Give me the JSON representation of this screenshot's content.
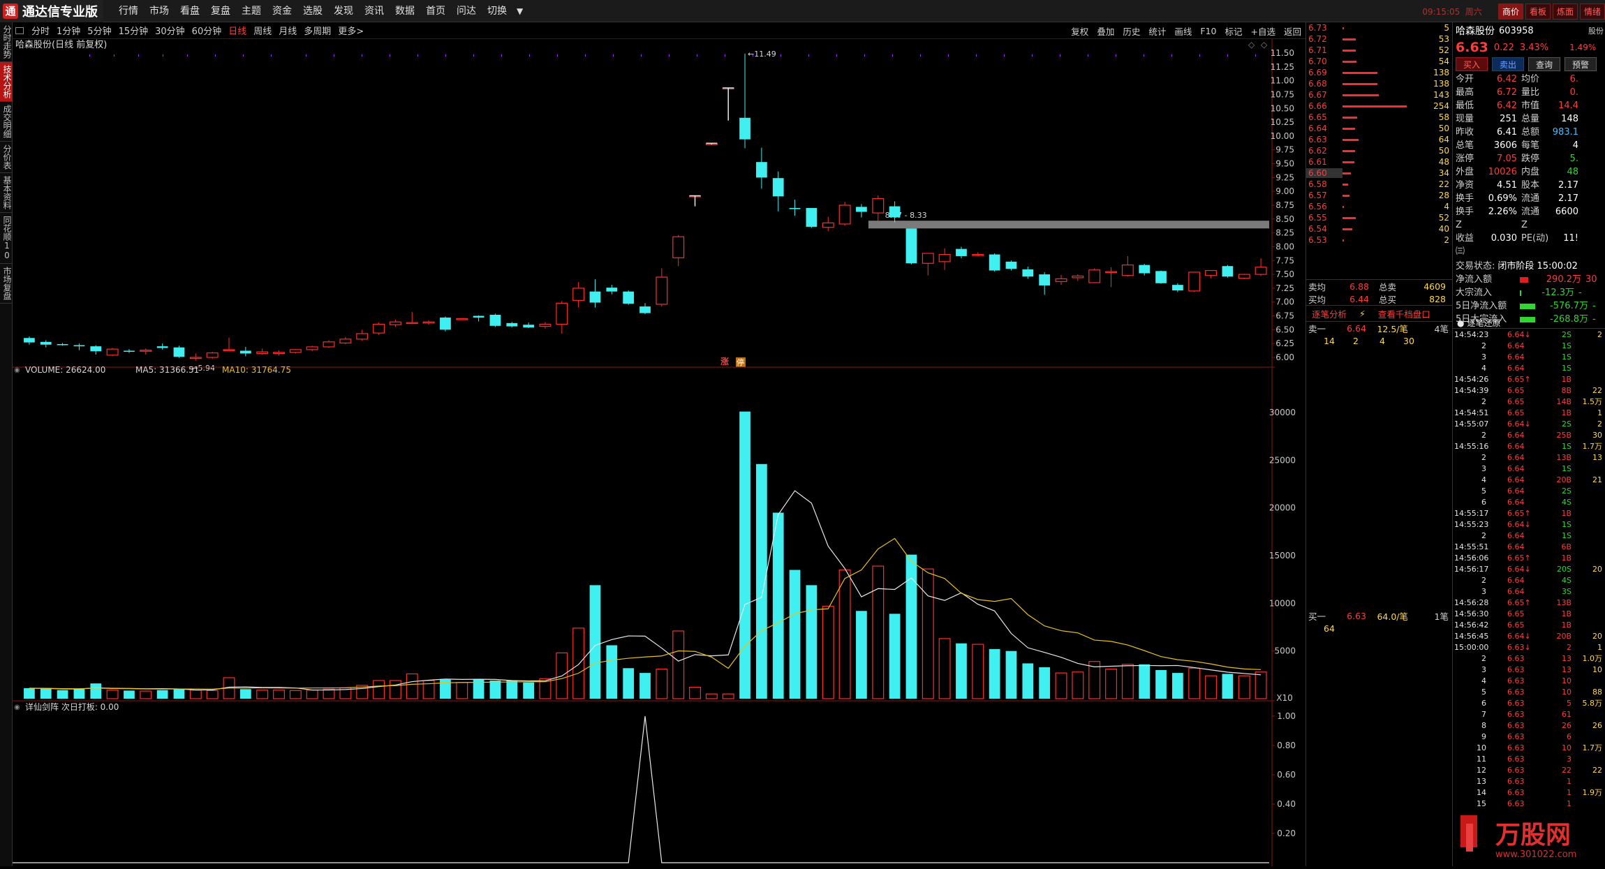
{
  "app": {
    "title": "通达信专业版",
    "logo_char": "通"
  },
  "menu": [
    "行情",
    "市场",
    "看盘",
    "复盘",
    "主题",
    "资金",
    "选股",
    "发现",
    "资讯",
    "数据",
    "首页",
    "问达",
    "切换"
  ],
  "clock": {
    "time": "09:15:05",
    "weekday": "周六"
  },
  "top_right_buttons": [
    {
      "label": "商价",
      "active": true
    },
    {
      "label": "看板",
      "active": false
    },
    {
      "label": "炼面",
      "active": false
    },
    {
      "label": "情绪",
      "active": false
    }
  ],
  "left_tabs": [
    {
      "label": "分时走势",
      "active": false
    },
    {
      "label": "技术分析",
      "active": true
    },
    {
      "label": "成交明细",
      "active": false
    },
    {
      "label": "分价表",
      "active": false
    },
    {
      "label": "基本资料",
      "active": false
    },
    {
      "label": "同花顺10",
      "active": false
    },
    {
      "label": "市场复盘",
      "active": false
    }
  ],
  "periods": [
    {
      "label": "分时",
      "active": false
    },
    {
      "label": "1分钟",
      "active": false
    },
    {
      "label": "5分钟",
      "active": false
    },
    {
      "label": "15分钟",
      "active": false
    },
    {
      "label": "30分钟",
      "active": false
    },
    {
      "label": "60分钟",
      "active": false
    },
    {
      "label": "日线",
      "active": true
    },
    {
      "label": "周线",
      "active": false
    },
    {
      "label": "月线",
      "active": false
    },
    {
      "label": "多周期",
      "active": false
    },
    {
      "label": "更多>",
      "active": false
    }
  ],
  "tools": [
    "复权",
    "叠加",
    "历史",
    "统计",
    "画线",
    "F10",
    "标记",
    "+自选",
    "返回"
  ],
  "chart_title": "哈森股份(日线 前复权)",
  "price_axis": [
    "11.50",
    "11.25",
    "11.00",
    "10.75",
    "10.50",
    "10.25",
    "10.00",
    "9.75",
    "9.50",
    "9.25",
    "9.00",
    "8.75",
    "8.50",
    "8.25",
    "8.00",
    "7.75",
    "7.50",
    "7.25",
    "7.00",
    "6.75",
    "6.50",
    "6.25",
    "6.00"
  ],
  "annotations": {
    "high": "11.49",
    "low": "5.94",
    "range": "8.47 - 8.33",
    "zhang": "涨",
    "ting": "停"
  },
  "volume_legend": {
    "volume": "VOLUME: 26624.00",
    "ma5": "MA5: 31366.51",
    "ma10": "MA10: 31764.75"
  },
  "volume_axis": [
    "30000",
    "25000",
    "20000",
    "15000",
    "10000",
    "5000"
  ],
  "volume_unit": "X10",
  "indicator_legend": "详仙剑阵 次日打板: 0.00",
  "indicator_axis": [
    "1.00",
    "0.80",
    "0.60",
    "0.40",
    "0.20"
  ],
  "colors": {
    "up": "#ff2b2b",
    "down": "#40f0f0",
    "ma5": "#e8e8e8",
    "ma10": "#e8c020"
  },
  "chart_data": {
    "type": "candlestick",
    "ohlc": [
      [
        6.35,
        6.38,
        6.23,
        6.27
      ],
      [
        6.28,
        6.31,
        6.18,
        6.23
      ],
      [
        6.24,
        6.26,
        6.21,
        6.23
      ],
      [
        6.22,
        6.25,
        6.13,
        6.2
      ],
      [
        6.2,
        6.22,
        6.05,
        6.11
      ],
      [
        6.04,
        6.17,
        6.02,
        6.15
      ],
      [
        6.12,
        6.15,
        6.08,
        6.11
      ],
      [
        6.11,
        6.16,
        6.05,
        6.13
      ],
      [
        6.2,
        6.25,
        6.14,
        6.17
      ],
      [
        6.18,
        6.21,
        5.99,
        6.01
      ],
      [
        5.98,
        6.07,
        5.94,
        6.0
      ],
      [
        6.0,
        6.1,
        5.97,
        6.08
      ],
      [
        6.13,
        6.36,
        6.11,
        6.14
      ],
      [
        6.12,
        6.19,
        6.02,
        6.07
      ],
      [
        6.07,
        6.16,
        6.05,
        6.1
      ],
      [
        6.07,
        6.13,
        6.03,
        6.09
      ],
      [
        6.09,
        6.15,
        6.07,
        6.14
      ],
      [
        6.14,
        6.21,
        6.11,
        6.19
      ],
      [
        6.19,
        6.31,
        6.17,
        6.28
      ],
      [
        6.26,
        6.37,
        6.24,
        6.33
      ],
      [
        6.33,
        6.5,
        6.3,
        6.43
      ],
      [
        6.44,
        6.63,
        6.41,
        6.6
      ],
      [
        6.59,
        6.68,
        6.55,
        6.64
      ],
      [
        6.63,
        6.82,
        6.6,
        6.63
      ],
      [
        6.62,
        6.67,
        6.59,
        6.64
      ],
      [
        6.72,
        6.74,
        6.47,
        6.5
      ],
      [
        6.69,
        6.71,
        6.68,
        6.7
      ],
      [
        6.75,
        6.76,
        6.65,
        6.72
      ],
      [
        6.77,
        6.79,
        6.55,
        6.57
      ],
      [
        6.62,
        6.64,
        6.54,
        6.56
      ],
      [
        6.59,
        6.63,
        6.53,
        6.54
      ],
      [
        6.56,
        6.64,
        6.52,
        6.6
      ],
      [
        6.6,
        7.02,
        6.43,
        6.98
      ],
      [
        7.03,
        7.36,
        6.9,
        7.25
      ],
      [
        7.19,
        7.41,
        6.9,
        6.99
      ],
      [
        7.26,
        7.31,
        7.14,
        7.19
      ],
      [
        7.19,
        7.21,
        6.95,
        6.97
      ],
      [
        6.92,
        6.98,
        6.78,
        6.8
      ],
      [
        6.96,
        7.61,
        6.92,
        7.45
      ],
      [
        7.8,
        8.21,
        7.65,
        8.18
      ],
      [
        8.92,
        8.92,
        8.73,
        8.92
      ],
      [
        9.86,
        9.87,
        9.85,
        9.86
      ],
      [
        10.85,
        10.87,
        10.28,
        10.87
      ],
      [
        10.33,
        11.49,
        9.78,
        9.94
      ],
      [
        9.53,
        9.79,
        9.05,
        9.25
      ],
      [
        9.24,
        9.36,
        8.64,
        8.91
      ],
      [
        8.7,
        8.85,
        8.56,
        8.68
      ],
      [
        8.7,
        8.7,
        8.34,
        8.36
      ],
      [
        8.35,
        8.54,
        8.28,
        8.43
      ],
      [
        8.41,
        8.81,
        8.38,
        8.75
      ],
      [
        8.72,
        8.77,
        8.53,
        8.63
      ],
      [
        8.61,
        8.93,
        8.46,
        8.87
      ],
      [
        8.73,
        8.82,
        8.44,
        8.53
      ],
      [
        8.33,
        8.33,
        7.68,
        7.7
      ],
      [
        7.7,
        7.87,
        7.48,
        7.88
      ],
      [
        7.73,
        7.97,
        7.58,
        7.86
      ],
      [
        7.96,
        8.0,
        7.79,
        7.83
      ],
      [
        7.85,
        7.9,
        7.83,
        7.86
      ],
      [
        7.86,
        7.88,
        7.55,
        7.57
      ],
      [
        7.73,
        7.75,
        7.57,
        7.6
      ],
      [
        7.59,
        7.64,
        7.42,
        7.46
      ],
      [
        7.5,
        7.54,
        7.13,
        7.3
      ],
      [
        7.37,
        7.49,
        7.31,
        7.42
      ],
      [
        7.44,
        7.5,
        7.38,
        7.47
      ],
      [
        7.35,
        7.61,
        7.34,
        7.58
      ],
      [
        7.54,
        7.63,
        7.27,
        7.55
      ],
      [
        7.48,
        7.83,
        7.46,
        7.67
      ],
      [
        7.67,
        7.69,
        7.48,
        7.52
      ],
      [
        7.56,
        7.57,
        7.33,
        7.34
      ],
      [
        7.31,
        7.34,
        7.18,
        7.21
      ],
      [
        7.2,
        7.54,
        7.18,
        7.54
      ],
      [
        7.48,
        7.57,
        7.43,
        7.57
      ],
      [
        7.65,
        7.67,
        7.44,
        7.46
      ],
      [
        7.43,
        7.51,
        7.41,
        7.5
      ],
      [
        7.5,
        7.79,
        7.47,
        7.63
      ]
    ],
    "volume": [
      1100,
      1050,
      900,
      1000,
      1600,
      900,
      850,
      800,
      900,
      1050,
      900,
      850,
      2200,
      1000,
      900,
      900,
      850,
      900,
      1000,
      1150,
      1400,
      1900,
      1900,
      2600,
      1900,
      2000,
      1700,
      2000,
      1900,
      1900,
      1700,
      2100,
      4800,
      7400,
      11900,
      5600,
      3200,
      2700,
      3100,
      7100,
      1200,
      500,
      500,
      30100,
      24600,
      19500,
      13500,
      11900,
      9700,
      13500,
      9200,
      13900,
      8900,
      15100,
      13600,
      6300,
      5800,
      5700,
      5200,
      5000,
      3700,
      3300,
      2700,
      2800,
      3900,
      3100,
      3600,
      3600,
      3000,
      2700,
      3200,
      2400,
      2600,
      2400,
      2800
    ],
    "ma5": [
      1100,
      1080,
      1020,
      1010,
      1140,
      1090,
      1070,
      1040,
      1050,
      1020,
      910,
      920,
      1210,
      1240,
      1180,
      1180,
      1130,
      910,
      910,
      960,
      1070,
      1270,
      1430,
      1790,
      1940,
      2060,
      2020,
      2040,
      2020,
      1900,
      1860,
      1880,
      2380,
      3580,
      5580,
      6200,
      6580,
      6560,
      5300,
      3940,
      4620,
      4490,
      4590,
      9880,
      10620,
      19300,
      21800,
      20500,
      15990,
      13650,
      10680,
      11540,
      11450,
      12660,
      10780,
      10300,
      11100,
      9900,
      9200,
      6840,
      5340,
      4850,
      4340,
      3700,
      3340,
      3400,
      3460,
      3480,
      3460,
      3480,
      3260,
      3020,
      2780,
      2640,
      2500
    ],
    "ma10": [
      1100,
      1090,
      1050,
      1040,
      1110,
      1070,
      1050,
      1020,
      1010,
      1020,
      1020,
      1000,
      1110,
      1110,
      1140,
      1120,
      1110,
      1120,
      1130,
      1140,
      1220,
      1330,
      1370,
      1510,
      1570,
      1660,
      1700,
      1710,
      1740,
      1750,
      1770,
      1780,
      2110,
      2670,
      3730,
      4040,
      4240,
      4370,
      4480,
      5010,
      4960,
      4360,
      3180,
      5510,
      7140,
      7960,
      8900,
      9310,
      9430,
      12600,
      13500,
      15700,
      16800,
      14400,
      13200,
      12600,
      11050,
      10390,
      10200,
      10500,
      8810,
      7630,
      7130,
      6900,
      6140,
      6010,
      5630,
      5040,
      4410,
      4090,
      3920,
      3640,
      3310,
      3120,
      3050
    ],
    "indicator_peak_index": 37,
    "ylim_price": [
      6.0,
      11.5
    ],
    "ylim_volume": [
      0,
      30000
    ],
    "ylim_indicator": [
      0,
      1
    ]
  },
  "order_book": {
    "asks": [
      {
        "price": "6.73",
        "vol": "5"
      },
      {
        "price": "6.72",
        "vol": "53"
      },
      {
        "price": "6.71",
        "vol": "52"
      },
      {
        "price": "6.70",
        "vol": "54"
      },
      {
        "price": "6.69",
        "vol": "138"
      },
      {
        "price": "6.68",
        "vol": "138"
      },
      {
        "price": "6.67",
        "vol": "143"
      },
      {
        "price": "6.66",
        "vol": "254"
      },
      {
        "price": "6.65",
        "vol": "58"
      },
      {
        "price": "6.64",
        "vol": "50"
      },
      {
        "price": "6.63",
        "vol": "64"
      },
      {
        "price": "6.62",
        "vol": "50"
      },
      {
        "price": "6.61",
        "vol": "48"
      },
      {
        "price": "6.60",
        "vol": "34"
      },
      {
        "price": "6.58",
        "vol": "22"
      },
      {
        "price": "6.57",
        "vol": "28"
      },
      {
        "price": "6.56",
        "vol": "4"
      },
      {
        "price": "6.55",
        "vol": "52"
      },
      {
        "price": "6.54",
        "vol": "40"
      },
      {
        "price": "6.53",
        "vol": "2"
      }
    ],
    "selected_index": 13,
    "summary": [
      {
        "k": "卖均",
        "v": "6.88",
        "k2": "总卖",
        "v2": "4609"
      },
      {
        "k": "买均",
        "v": "6.44",
        "k2": "总买",
        "v2": "828"
      }
    ],
    "flow_link": "逐笔分析",
    "flow_link2": "查看千档盘口",
    "sell1": {
      "k": "卖一",
      "price": "6.64",
      "per": "12.5/笔",
      "cnt": "4笔",
      "q": [
        "14",
        "2",
        "4",
        "30"
      ]
    },
    "buy1": {
      "k": "买一",
      "price": "6.63",
      "per": "64.0/笔",
      "cnt": "1笔",
      "q": [
        "64"
      ]
    }
  },
  "stock": {
    "name": "哈森股份",
    "code": "603958",
    "extra": "股份",
    "price": "6.63",
    "change": "0.22",
    "pct": "3.43%",
    "pct2": "1.49%"
  },
  "trade_buttons": [
    "买入",
    "卖出",
    "查询",
    "预警"
  ],
  "fields": [
    [
      "今开",
      "6.42",
      "均价",
      "6."
    ],
    [
      "最高",
      "6.72",
      "量比",
      "0."
    ],
    [
      "最低",
      "6.42",
      "市值",
      "14.4"
    ],
    [
      "现量",
      "251",
      "总量",
      "148"
    ],
    [
      "昨收",
      "6.41",
      "总额",
      "983.1"
    ],
    [
      "总笔",
      "3606",
      "每笔",
      "4"
    ],
    [
      "涨停",
      "7.05",
      "跌停",
      "5."
    ],
    [
      "外盘",
      "10026",
      "内盘",
      "48"
    ],
    [
      "净资",
      "4.51",
      "股本",
      "2.17"
    ],
    [
      "换手",
      "0.69%",
      "流通",
      "2.17"
    ],
    [
      "换手Z",
      "2.26%",
      "流通Z",
      "6600"
    ],
    [
      "收益㈢",
      "0.030",
      "PE(动)",
      "11!"
    ]
  ],
  "trade_state": {
    "label": "交易状态:",
    "value": "闭市阶段 15:00:02"
  },
  "fund_flow": [
    {
      "k": "净流入额",
      "v": "290.2万",
      "v2": "30"
    },
    {
      "k": "大宗流入",
      "v": "-12.3万",
      "v2": "-"
    },
    {
      "k": "5日净流入额",
      "v": "-576.7万",
      "v2": "-"
    },
    {
      "k": "5日大宗流入",
      "v": "-268.8万",
      "v2": "-"
    }
  ],
  "tick_header": "逐笔还原",
  "ticks": [
    {
      "t": "14:54:23",
      "p": "6.64↓",
      "v": "2S",
      "n": "2"
    },
    {
      "t": "2",
      "p": "6.64",
      "v": "1S",
      "n": ""
    },
    {
      "t": "3",
      "p": "6.64",
      "v": "1S",
      "n": ""
    },
    {
      "t": "4",
      "p": "6.64",
      "v": "1S",
      "n": ""
    },
    {
      "t": "14:54:26",
      "p": "6.65↑",
      "v": "1B",
      "n": ""
    },
    {
      "t": "14:54:39",
      "p": "6.65",
      "v": "8B",
      "n": "22"
    },
    {
      "t": "2",
      "p": "6.65",
      "v": "14B",
      "n": "1.5万"
    },
    {
      "t": "14:54:51",
      "p": "6.65",
      "v": "1B",
      "n": "1"
    },
    {
      "t": "14:55:07",
      "p": "6.64↓",
      "v": "2S",
      "n": "2"
    },
    {
      "t": "2",
      "p": "6.64",
      "v": "25B",
      "n": "30"
    },
    {
      "t": "14:55:16",
      "p": "6.64",
      "v": "1S",
      "n": "1.7万"
    },
    {
      "t": "2",
      "p": "6.64",
      "v": "13B",
      "n": "13"
    },
    {
      "t": "3",
      "p": "6.64",
      "v": "1S",
      "n": ""
    },
    {
      "t": "4",
      "p": "6.64",
      "v": "20B",
      "n": "21"
    },
    {
      "t": "5",
      "p": "6.64",
      "v": "2S",
      "n": ""
    },
    {
      "t": "6",
      "p": "6.64",
      "v": "4S",
      "n": ""
    },
    {
      "t": "14:55:17",
      "p": "6.65↑",
      "v": "1B",
      "n": ""
    },
    {
      "t": "14:55:23",
      "p": "6.64↓",
      "v": "1S",
      "n": ""
    },
    {
      "t": "2",
      "p": "6.64",
      "v": "1S",
      "n": ""
    },
    {
      "t": "14:55:51",
      "p": "6.64",
      "v": "6B",
      "n": ""
    },
    {
      "t": "14:56:06",
      "p": "6.65↑",
      "v": "1B",
      "n": ""
    },
    {
      "t": "14:56:17",
      "p": "6.64↓",
      "v": "20S",
      "n": "20"
    },
    {
      "t": "2",
      "p": "6.64",
      "v": "4S",
      "n": ""
    },
    {
      "t": "3",
      "p": "6.64",
      "v": "3S",
      "n": ""
    },
    {
      "t": "14:56:28",
      "p": "6.65↑",
      "v": "13B",
      "n": ""
    },
    {
      "t": "14:56:30",
      "p": "6.65",
      "v": "1B",
      "n": ""
    },
    {
      "t": "14:56:42",
      "p": "6.65",
      "v": "1B",
      "n": ""
    },
    {
      "t": "14:56:45",
      "p": "6.64↓",
      "v": "20B",
      "n": "20"
    },
    {
      "t": "15:00:00",
      "p": "6.63↓",
      "v": "2",
      "n": "1"
    },
    {
      "t": "2",
      "p": "6.63",
      "v": "13",
      "n": "1.0万"
    },
    {
      "t": "3",
      "p": "6.63",
      "v": "13",
      "n": "10"
    },
    {
      "t": "4",
      "p": "6.63",
      "v": "10",
      "n": ""
    },
    {
      "t": "5",
      "p": "6.63",
      "v": "10",
      "n": "88"
    },
    {
      "t": "6",
      "p": "6.63",
      "v": "5",
      "n": "5.8万"
    },
    {
      "t": "7",
      "p": "6.63",
      "v": "61",
      "n": ""
    },
    {
      "t": "8",
      "p": "6.63",
      "v": "26",
      "n": "26"
    },
    {
      "t": "9",
      "p": "6.63",
      "v": "6",
      "n": ""
    },
    {
      "t": "10",
      "p": "6.63",
      "v": "10",
      "n": "1.7万"
    },
    {
      "t": "11",
      "p": "6.63",
      "v": "3",
      "n": ""
    },
    {
      "t": "12",
      "p": "6.63",
      "v": "22",
      "n": "22"
    },
    {
      "t": "13",
      "p": "6.63",
      "v": "1",
      "n": ""
    },
    {
      "t": "14",
      "p": "6.63",
      "v": "1",
      "n": "1.9万"
    },
    {
      "t": "15",
      "p": "6.63",
      "v": "1",
      "n": ""
    }
  ],
  "watermark": {
    "text": "万股网",
    "url": "www.301022.com"
  }
}
